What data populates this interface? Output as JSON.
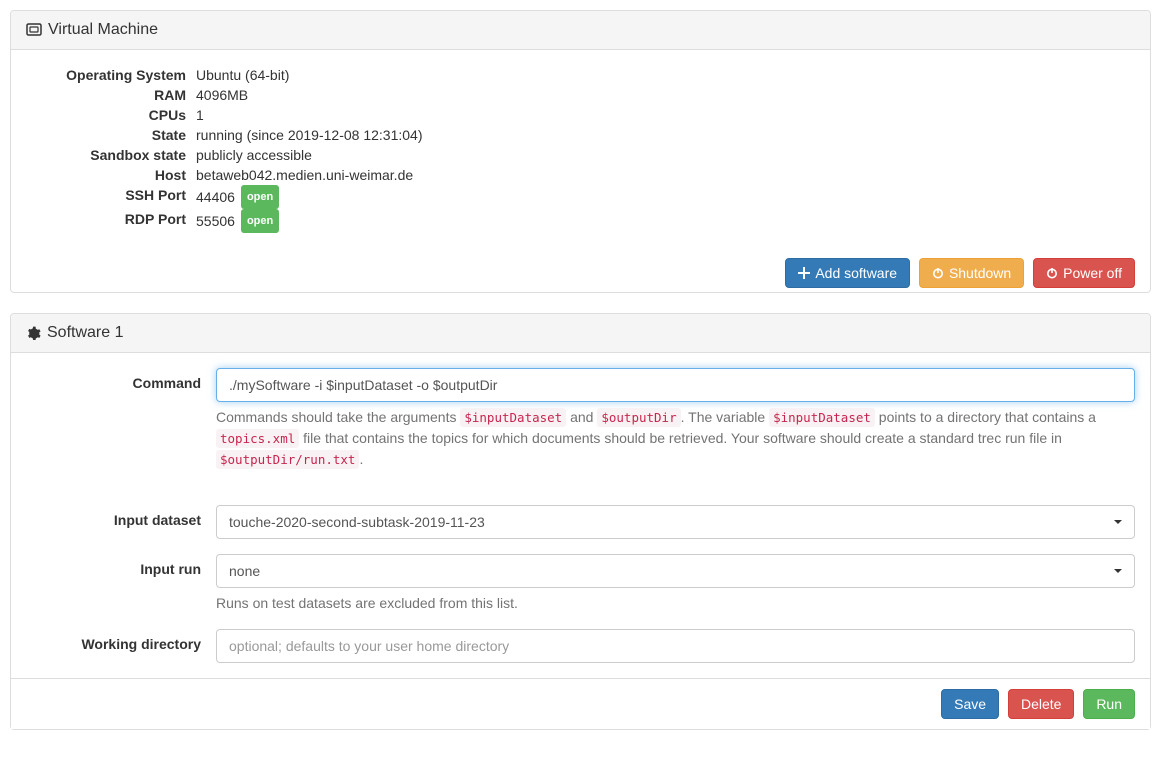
{
  "vm_panel": {
    "title": "Virtual Machine",
    "rows": {
      "os_label": "Operating System",
      "os_value": "Ubuntu (64-bit)",
      "ram_label": "RAM",
      "ram_value": "4096MB",
      "cpus_label": "CPUs",
      "cpus_value": "1",
      "state_label": "State",
      "state_value": "running (since 2019-12-08 12:31:04)",
      "sandbox_label": "Sandbox state",
      "sandbox_value": "publicly accessible",
      "host_label": "Host",
      "host_value": "betaweb042.medien.uni-weimar.de",
      "ssh_label": "SSH Port",
      "ssh_value": "44406",
      "ssh_badge": "open",
      "rdp_label": "RDP Port",
      "rdp_value": "55506",
      "rdp_badge": "open"
    },
    "buttons": {
      "add_software": "Add software",
      "shutdown": "Shutdown",
      "power_off": "Power off"
    }
  },
  "software_panel": {
    "title": "Software 1",
    "command_label": "Command",
    "command_value": "./mySoftware -i $inputDataset -o $outputDir",
    "help": {
      "p1_a": "Commands should take the arguments ",
      "code1": "$inputDataset",
      "p1_b": " and ",
      "code2": "$outputDir",
      "p1_c": ". The variable ",
      "code3": "$inputDataset",
      "p1_d": " points to a directory that contains a ",
      "code4": "topics.xml",
      "p1_e": " file that contains the topics for which documents should be retrieved. Your software should create a standard trec run file in ",
      "code5": "$outputDir/run.txt",
      "p1_f": "."
    },
    "dataset_label": "Input dataset",
    "dataset_value": "touche-2020-second-subtask-2019-11-23",
    "run_label": "Input run",
    "run_value": "none",
    "run_help": "Runs on test datasets are excluded from this list.",
    "workdir_label": "Working directory",
    "workdir_placeholder": "optional; defaults to your user home directory",
    "buttons": {
      "save": "Save",
      "delete": "Delete",
      "run": "Run"
    }
  }
}
